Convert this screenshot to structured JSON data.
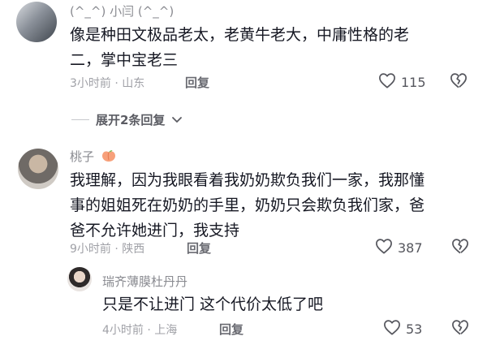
{
  "comments": [
    {
      "username": "(^_^) 小闫 (^_^)",
      "text_line1": "像是种田文极品老太，老黄牛老大，中庸性格的老",
      "text_line2": "二，掌中宝老三",
      "meta": "3小时前 · 山东",
      "reply_label": "回复",
      "likes": "115"
    },
    {
      "username": "桃子",
      "badge_icon": "peach-icon",
      "text_line1": "我理解，因为我眼看着我奶奶欺负我们一家，我那懂",
      "text_line2": "事的姐姐死在奶奶的手里，奶奶只会欺负我们家，爸",
      "text_line3": "爸不允许她进门，我支持",
      "meta": "9小时前 · 陕西",
      "reply_label": "回复",
      "likes": "387"
    },
    {
      "username": "瑞齐薄膜杜丹丹",
      "text_line1": "只是不让进门  这个代价太低了吧",
      "meta": "4小时前 · 上海",
      "reply_label": "回复",
      "likes": "53"
    }
  ],
  "expand_replies": {
    "label": "展开2条回复"
  },
  "colors": {
    "text": "#161823",
    "muted": "#a0a1a7",
    "peach": "#f7a07a"
  }
}
